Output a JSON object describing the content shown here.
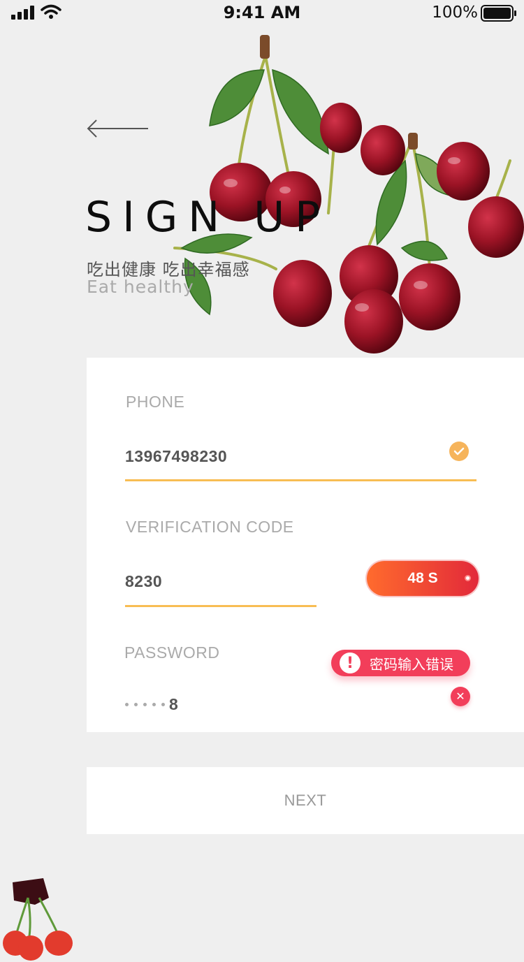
{
  "status_bar": {
    "time": "9:41 AM",
    "battery": "100%"
  },
  "hero": {
    "title": "SIGN UP",
    "subtitle_cn": "吃出健康  吃出幸福感",
    "subtitle_en": "Eat  healthy"
  },
  "form": {
    "phone": {
      "label": "PHONE",
      "value": "13967498230"
    },
    "code": {
      "label": "VERIFICATION CODE",
      "value": "8230",
      "timer": "48 S"
    },
    "password": {
      "label": "PASSWORD",
      "last_char": "8",
      "error": "密码输入错误"
    }
  },
  "next_label": "NEXT",
  "colors": {
    "accent_line": "#f8bd53",
    "error": "#f23e5a",
    "timer_start": "#ff6b2d",
    "timer_end": "#e2293a"
  }
}
